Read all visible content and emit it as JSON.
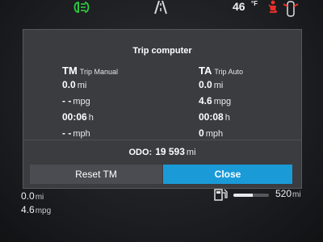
{
  "status_bar": {
    "temperature": "46",
    "temperature_unit": "°F",
    "icons": [
      "headlight-indicator-icon",
      "lane-assist-icon",
      "seatbelt-warning-icon",
      "door-open-icon"
    ],
    "colors": {
      "headlight": "#2ecc40",
      "warning": "#e8302a"
    }
  },
  "dialog": {
    "title": "Trip computer",
    "trip_manual": {
      "code": "TM",
      "name": "Trip Manual",
      "distance": {
        "value": "0.0",
        "unit": "mi"
      },
      "economy": {
        "value": "- -",
        "unit": "mpg"
      },
      "time": {
        "value": "00:06",
        "unit": "h"
      },
      "speed": {
        "value": "- -",
        "unit": "mph"
      }
    },
    "trip_auto": {
      "code": "TA",
      "name": "Trip Auto",
      "distance": {
        "value": "0.0",
        "unit": "mi"
      },
      "economy": {
        "value": "4.6",
        "unit": "mpg"
      },
      "time": {
        "value": "00:08",
        "unit": "h"
      },
      "speed": {
        "value": "0",
        "unit": "mph"
      }
    },
    "odometer": {
      "label": "ODO:",
      "value": "19 593",
      "unit": "mi"
    },
    "buttons": {
      "reset": "Reset TM",
      "close": "Close"
    },
    "accent_color": "#1a9bd8"
  },
  "bottom": {
    "distance": {
      "value": "0.0",
      "unit": "mi"
    },
    "economy": {
      "value": "4.6",
      "unit": "mpg"
    },
    "fuel_level_fraction": 0.55,
    "range": {
      "value": "520",
      "unit": "mi"
    }
  }
}
